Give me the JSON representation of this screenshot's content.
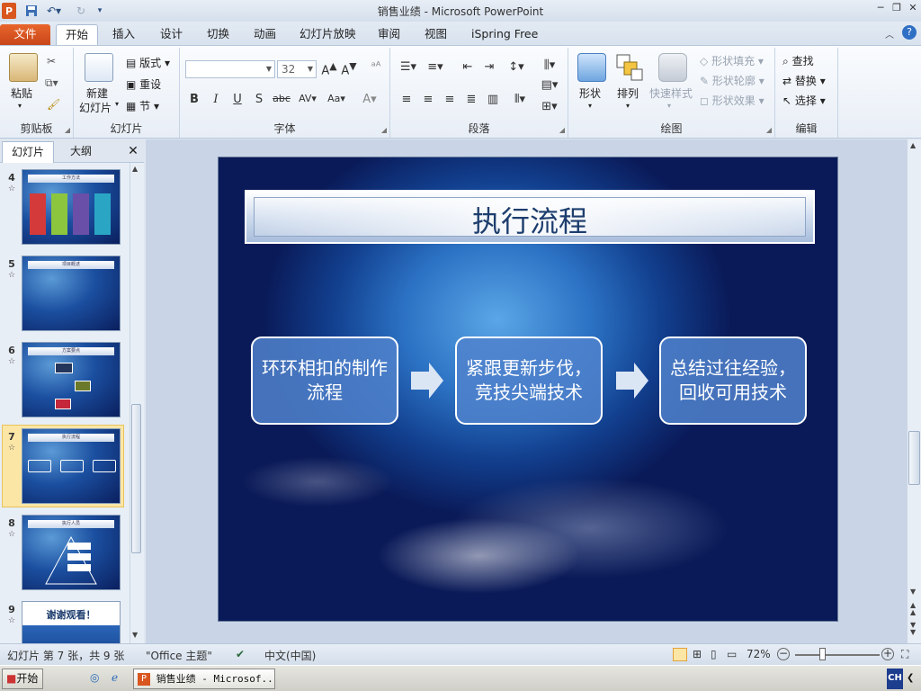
{
  "window": {
    "title": "销售业绩 - Microsoft PowerPoint"
  },
  "ribbon_tabs": [
    "文件",
    "开始",
    "插入",
    "设计",
    "切换",
    "动画",
    "幻灯片放映",
    "审阅",
    "视图",
    "iSpring Free"
  ],
  "ribbon": {
    "clipboard": {
      "label": "剪贴板",
      "paste": "粘贴"
    },
    "slides": {
      "label": "幻灯片",
      "new_slide_1": "新建",
      "new_slide_2": "幻灯片",
      "layout": "版式",
      "reset": "重设",
      "section": "节"
    },
    "font": {
      "label": "字体",
      "font_name": "",
      "font_size": "32"
    },
    "paragraph": {
      "label": "段落"
    },
    "drawing": {
      "label": "绘图",
      "shapes": "形状",
      "arrange": "排列",
      "quick_styles": "快速样式",
      "fill": "形状填充",
      "outline": "形状轮廓",
      "effects": "形状效果"
    },
    "editing": {
      "label": "编辑",
      "find": "查找",
      "replace": "替换",
      "select": "选择"
    }
  },
  "panel": {
    "tab_slides": "幻灯片",
    "tab_outline": "大纲",
    "slides": [
      {
        "num": "4",
        "thumb_title": "工作方法"
      },
      {
        "num": "5",
        "thumb_title": "项目概述"
      },
      {
        "num": "6",
        "thumb_title": "方案要点"
      },
      {
        "num": "7",
        "thumb_title": "执行流程"
      },
      {
        "num": "8",
        "thumb_title": "执行人员"
      },
      {
        "num": "9",
        "thumb_title": "谢谢观看！"
      }
    ],
    "selected_slide": "7"
  },
  "slide": {
    "title": "执行流程",
    "steps": [
      "环环相扣的制作流程",
      "紧跟更新步伐，竞技尖端技术",
      "总结过往经验，回收可用技术"
    ]
  },
  "status": {
    "slide_info": "幻灯片 第 7 张，共 9 张",
    "theme": "\"Office 主题\"",
    "language": "中文(中国)",
    "zoom": "72%"
  },
  "taskbar": {
    "start": "开始",
    "window_item": "销售业绩 - Microsof...",
    "ime": "CH"
  },
  "colors": {
    "file_tab": "#d9561f",
    "slide_text": "#1d3d6e",
    "selection": "#f6c342"
  }
}
